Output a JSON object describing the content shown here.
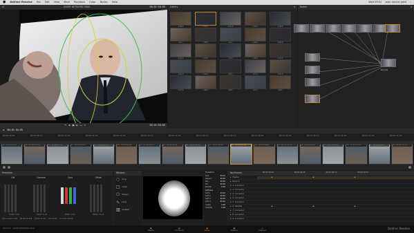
{
  "menubar": {
    "app_name": "DaVinci Resolve",
    "menus": [
      "File",
      "Edit",
      "View",
      "Mark",
      "Playback",
      "Color",
      "Nodes",
      "Help"
    ],
    "clock": "Wed 09:51",
    "user": "Jean-michel petit"
  },
  "viewer": {
    "clip_name": "SHORT NETWORK GRAD",
    "timecode": "00:01:04:05",
    "timecode_bottom": "00:01:04:05"
  },
  "gallery": {
    "title": "Gallery",
    "stills": [
      {
        "label": "1.20.1"
      },
      {
        "label": "1.19.1"
      },
      {
        "label": "1.21.1"
      },
      {
        "label": "1.19.1"
      },
      {
        "label": "1.18.1"
      },
      {
        "label": "1.9.1"
      },
      {
        "label": "1.33.1"
      },
      {
        "label": "1.4.1"
      },
      {
        "label": "1.16.1"
      },
      {
        "label": "1.19.1"
      },
      {
        "label": "1.15.1"
      },
      {
        "label": "1.13.1"
      },
      {
        "label": "1.2.1"
      },
      {
        "label": "1.16.1"
      },
      {
        "label": "1.14.1"
      },
      {
        "label": "1.10.1"
      },
      {
        "label": "1.11.1"
      },
      {
        "label": "1.5.1"
      },
      {
        "label": "1.7.1"
      },
      {
        "label": "1.12.1"
      },
      {
        "label": "1.17.1"
      },
      {
        "label": "1.20.1"
      },
      {
        "label": "1.8.1"
      },
      {
        "label": "1.3.1"
      },
      {
        "label": "1.6.1"
      }
    ]
  },
  "nodes": {
    "title": "Nodes",
    "output_label": "Parallel"
  },
  "transport": {
    "timecode": "00:01:04:05"
  },
  "ruler_times": [
    "00:00:00:00",
    "00:00:08:21",
    "00:00:17:10",
    "00:00:26:05",
    "00:00:34:20",
    "00:00:43:13",
    "00:00:52:04",
    "00:01:00:21",
    "00:01:09:12",
    "00:01:18:05",
    "00:01:26:22",
    "00:01:35:13",
    "00:01:44:06",
    "00:01:52:21",
    "00:02:01:14"
  ],
  "clips": [
    {
      "num": "01",
      "tc": "00:00:19:10"
    },
    {
      "num": "02",
      "tc": "00:00:21:08"
    },
    {
      "num": "03",
      "tc": "00:00:23:11"
    },
    {
      "num": "04",
      "tc": "00:00:25:13"
    },
    {
      "num": "05",
      "tc": "00:00:32:07"
    },
    {
      "num": "06",
      "tc": "00:00:36:05"
    },
    {
      "num": "07",
      "tc": "00:00:44:03"
    },
    {
      "num": "08",
      "tc": "00:00:48:21"
    },
    {
      "num": "09",
      "tc": "00:00:52:00"
    },
    {
      "num": "10",
      "tc": "00:01:00:14"
    },
    {
      "num": "11",
      "tc": "00:01:04:05"
    },
    {
      "num": "12",
      "tc": "00:01:06:00"
    },
    {
      "num": "13",
      "tc": "00:01:11:10"
    },
    {
      "num": "14",
      "tc": "00:01:16:18"
    },
    {
      "num": "15",
      "tc": "00:01:19:00"
    },
    {
      "num": "16",
      "tc": "00:01:23:11"
    },
    {
      "num": "17",
      "tc": "00:01:28:04"
    },
    {
      "num": "18",
      "tc": "00:01:31:18"
    }
  ],
  "primaries": {
    "title": "Primaries",
    "wheels": [
      "Lift",
      "Gamma",
      "Gain",
      "Offset"
    ],
    "readouts": [
      "YRGB Y 0.00",
      "YRGB Y 0.00",
      "YRGB Y 0.00",
      "YRGB Y 25.00"
    ],
    "footer": [
      "HP Contrast 1.000",
      "HP Pivot 0.435",
      "HP Sat 50.00",
      "Hue 50.00",
      "Lum Mix 100.00"
    ]
  },
  "window": {
    "title": "Window",
    "shapes": [
      "Circle",
      "Linear",
      "Polygon",
      "Curve",
      "Gradient"
    ]
  },
  "transform": {
    "title": "Transform",
    "fields": [
      {
        "label": "Size",
        "value": "50.00"
      },
      {
        "label": "Aspect",
        "value": "50.00"
      },
      {
        "label": "Pan",
        "value": "50.00"
      },
      {
        "label": "Tilt",
        "value": "50.00"
      },
      {
        "label": "Rotate",
        "value": "0.00"
      }
    ],
    "softness_title": "Softness",
    "softness": [
      {
        "label": "Soft 1",
        "value": "50.00"
      },
      {
        "label": "Soft 2",
        "value": "50.00"
      },
      {
        "label": "Soft 3",
        "value": "50.00"
      },
      {
        "label": "Soft 4",
        "value": "50.00"
      },
      {
        "label": "Inside",
        "value": "0.00"
      },
      {
        "label": "Outside",
        "value": "0.00"
      }
    ]
  },
  "keyframes": {
    "title": "Keyframes",
    "times": [
      "00:01:03:24",
      "00:01:04:06",
      "00:01:04:12",
      "00:01:04:17"
    ],
    "tracks": [
      "Master",
      "Node 1",
      "1: Corrector",
      "2: Corrector",
      "3: Corrector",
      "4: Corrector",
      "5: Corrector",
      "6: Parallel",
      "7: Corrector",
      "8: Corrector",
      "9: Corrector"
    ]
  },
  "footer": {
    "tabs": [
      "Media",
      "Conform",
      "Color",
      "Gallery",
      "Deliver"
    ],
    "active": "Color",
    "project": "JAM 2013 - SHORT NETWORK GRAD",
    "brand": "DaVinci Resolve"
  }
}
